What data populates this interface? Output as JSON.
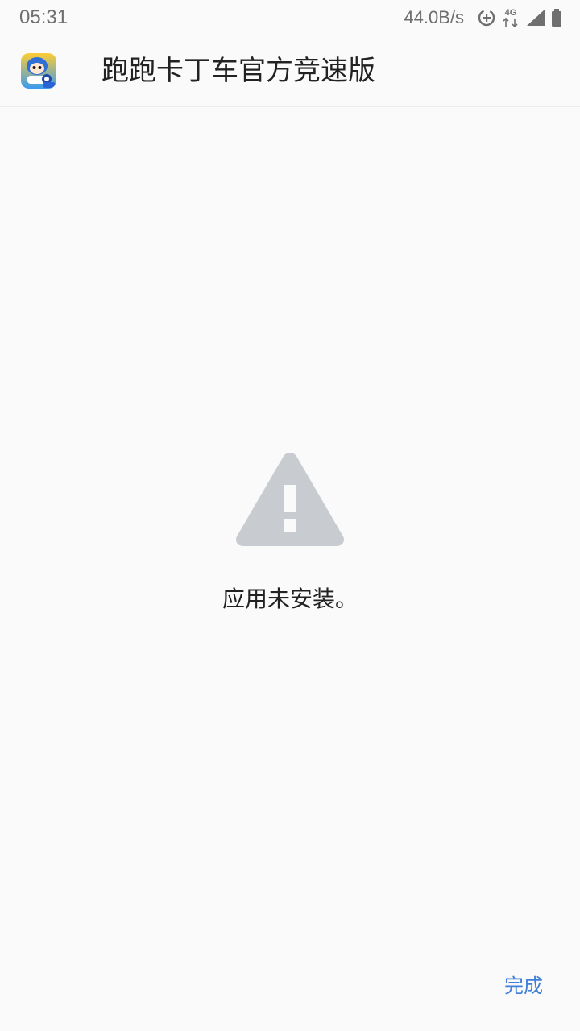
{
  "status_bar": {
    "time": "05:31",
    "net_speed": "44.0B/s",
    "network_type": "4G",
    "icons": [
      "data-saver-icon",
      "network-4g-icon",
      "signal-icon",
      "battery-icon"
    ]
  },
  "header": {
    "app_name": "跑跑卡丁车官方竞速版",
    "app_icon": "app-icon-kartrider"
  },
  "main": {
    "warning_icon": "warning-triangle-icon",
    "message": "应用未安装。"
  },
  "actions": {
    "done_label": "完成"
  },
  "colors": {
    "background": "#fafafa",
    "accent": "#3f7fd9",
    "icon_gray": "#c8ccd0",
    "text": "#222222",
    "status_text": "#6f6f6f"
  }
}
